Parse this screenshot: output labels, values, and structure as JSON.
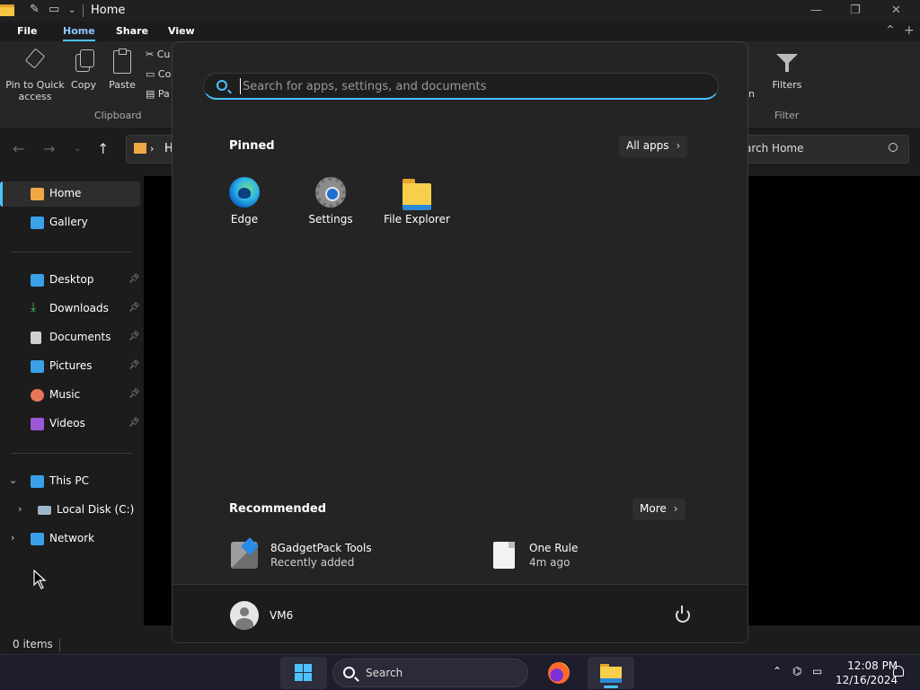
{
  "window": {
    "title": "Home",
    "menu_tabs": [
      "File",
      "Home",
      "Share",
      "View"
    ],
    "active_tab": "Home"
  },
  "ribbon": {
    "pin_label": "Pin to Quick access",
    "copy_label": "Copy",
    "paste_label": "Paste",
    "cut_label": "Cu",
    "copy_path_label": "Co",
    "paste_shortcut_label": "Pa",
    "clipboard_group": "Clipboard",
    "partial_label": "n",
    "filters_label": "Filters",
    "filter_group": "Filter"
  },
  "address": {
    "path_text": "H",
    "search_placeholder": "arch Home"
  },
  "sidebar": {
    "items": [
      {
        "label": "Home",
        "icon": "home-icon",
        "color": "#f0a845"
      },
      {
        "label": "Gallery",
        "icon": "gallery-icon",
        "color": "#3aa0e8"
      },
      {
        "label": "Desktop",
        "icon": "desktop-icon",
        "color": "#3aa0e8"
      },
      {
        "label": "Downloads",
        "icon": "download-icon",
        "color": "#3cc86a"
      },
      {
        "label": "Documents",
        "icon": "document-icon",
        "color": "#cfcfcf"
      },
      {
        "label": "Pictures",
        "icon": "pictures-icon",
        "color": "#3aa0e8"
      },
      {
        "label": "Music",
        "icon": "music-icon",
        "color": "#e8745a"
      },
      {
        "label": "Videos",
        "icon": "video-icon",
        "color": "#9b59d6"
      },
      {
        "label": "This PC",
        "icon": "pc-icon",
        "color": "#3aa0e8"
      },
      {
        "label": "Local Disk (C:)",
        "icon": "disk-icon",
        "color": "#9fb6c8"
      },
      {
        "label": "Network",
        "icon": "network-icon",
        "color": "#3aa0e8"
      }
    ]
  },
  "status": {
    "items_text": "0 items"
  },
  "start_menu": {
    "search_placeholder": "Search for apps, settings, and documents",
    "pinned_title": "Pinned",
    "all_apps_label": "All apps",
    "pinned_apps": [
      {
        "label": "Edge",
        "icon": "edge-icon"
      },
      {
        "label": "Settings",
        "icon": "settings-gear-icon"
      },
      {
        "label": "File Explorer",
        "icon": "folder-icon"
      }
    ],
    "recommended_title": "Recommended",
    "more_label": "More",
    "recommended": [
      {
        "name": "8GadgetPack Tools",
        "sub": "Recently added",
        "icon": "gadgetpack-icon"
      },
      {
        "name": "One Rule",
        "sub": "4m ago",
        "icon": "file-icon"
      }
    ],
    "user_name": "VM6"
  },
  "taskbar": {
    "search_placeholder": "Search",
    "time": "12:08 PM",
    "date": "12/16/2024"
  },
  "colors": {
    "accent": "#4cc2ff",
    "start_bg": "#242424",
    "taskbar_bg": "#1d1d2b"
  }
}
